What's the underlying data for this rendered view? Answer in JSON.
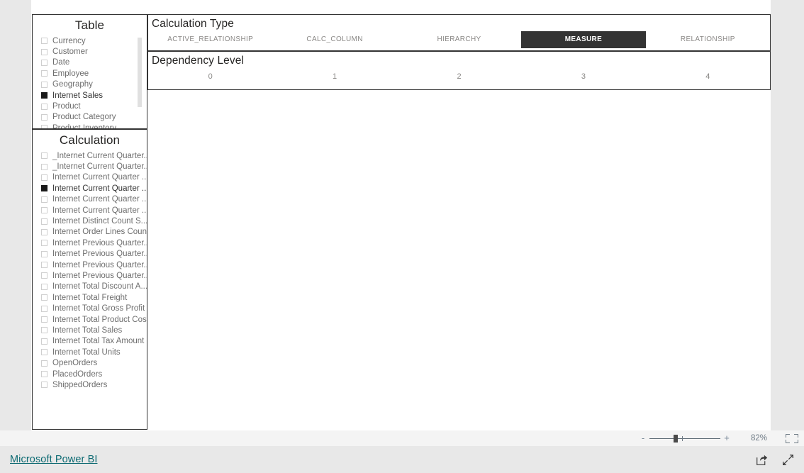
{
  "report": {
    "table_slicer": {
      "title": "Table",
      "items": [
        {
          "label": "Currency",
          "selected": false
        },
        {
          "label": "Customer",
          "selected": false
        },
        {
          "label": "Date",
          "selected": false
        },
        {
          "label": "Employee",
          "selected": false
        },
        {
          "label": "Geography",
          "selected": false
        },
        {
          "label": "Internet Sales",
          "selected": true
        },
        {
          "label": "Product",
          "selected": false
        },
        {
          "label": "Product Category",
          "selected": false
        },
        {
          "label": "Product Inventory",
          "selected": false
        }
      ]
    },
    "calculation_slicer": {
      "title": "Calculation",
      "items": [
        {
          "label": "_Internet Current Quarter...",
          "selected": false
        },
        {
          "label": "_Internet Current Quarter...",
          "selected": false
        },
        {
          "label": "Internet Current Quarter ...",
          "selected": false
        },
        {
          "label": "Internet Current Quarter ...",
          "selected": true
        },
        {
          "label": "Internet Current Quarter ...",
          "selected": false
        },
        {
          "label": "Internet Current Quarter ...",
          "selected": false
        },
        {
          "label": "Internet Distinct Count S...",
          "selected": false
        },
        {
          "label": "Internet Order Lines Count",
          "selected": false
        },
        {
          "label": "Internet Previous Quarter...",
          "selected": false
        },
        {
          "label": "Internet Previous Quarter...",
          "selected": false
        },
        {
          "label": "Internet Previous Quarter...",
          "selected": false
        },
        {
          "label": "Internet Previous Quarter...",
          "selected": false
        },
        {
          "label": "Internet Total Discount A...",
          "selected": false
        },
        {
          "label": "Internet Total Freight",
          "selected": false
        },
        {
          "label": "Internet Total Gross Profit",
          "selected": false
        },
        {
          "label": "Internet Total Product Cost",
          "selected": false
        },
        {
          "label": "Internet Total Sales",
          "selected": false
        },
        {
          "label": "Internet Total Tax Amount",
          "selected": false
        },
        {
          "label": "Internet Total Units",
          "selected": false
        },
        {
          "label": "OpenOrders",
          "selected": false
        },
        {
          "label": "PlacedOrders",
          "selected": false
        },
        {
          "label": "ShippedOrders",
          "selected": false
        }
      ]
    },
    "calculation_type": {
      "title": "Calculation Type",
      "items": [
        {
          "label": "ACTIVE_RELATIONSHIP",
          "selected": false
        },
        {
          "label": "CALC_COLUMN",
          "selected": false
        },
        {
          "label": "HIERARCHY",
          "selected": false
        },
        {
          "label": "MEASURE",
          "selected": true
        },
        {
          "label": "RELATIONSHIP",
          "selected": false
        }
      ]
    },
    "dependency_level": {
      "title": "Dependency Level",
      "items": [
        {
          "label": "0",
          "selected": false
        },
        {
          "label": "1",
          "selected": false
        },
        {
          "label": "2",
          "selected": false
        },
        {
          "label": "3",
          "selected": false
        },
        {
          "label": "4",
          "selected": false
        }
      ]
    }
  },
  "statusbar": {
    "zoom_out_label": "-",
    "zoom_in_label": "+",
    "zoom_percent": "82%",
    "fit_to_page_icon": "fit-to-page-icon"
  },
  "footer": {
    "brand": "Microsoft Power BI",
    "share_icon": "share-icon",
    "fullscreen_icon": "fullscreen-icon"
  },
  "colors": {
    "selected_fill": "#333333",
    "brand_link": "#0c6a72",
    "page_background": "#e8e8e8",
    "canvas": "#ffffff"
  }
}
